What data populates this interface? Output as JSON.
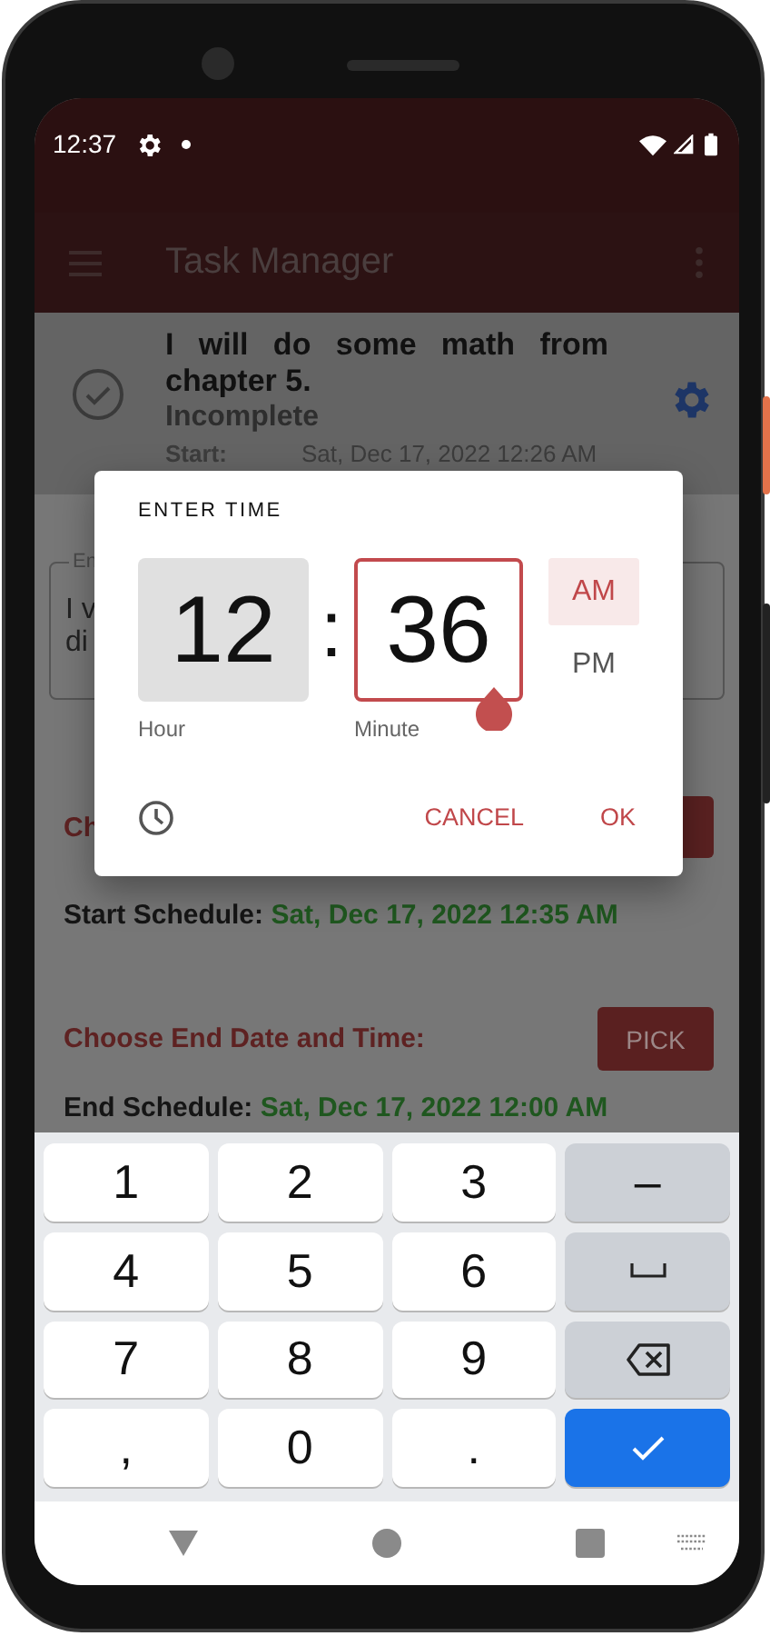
{
  "status_bar": {
    "time": "12:37"
  },
  "app_bar": {
    "title": "Task Manager"
  },
  "task": {
    "title": "I will do some math from chapter 5.",
    "status": "Incomplete",
    "start_label": "Start:",
    "start_value": "Sat, Dec 17, 2022 12:26 AM"
  },
  "form": {
    "field_label": "En",
    "field_lines": [
      "I v",
      "di"
    ],
    "start_heading": "Ch",
    "start_schedule_label": "Start Schedule:",
    "start_schedule_value": "Sat, Dec 17, 2022 12:35 AM",
    "end_heading": "Choose End Date and Time:",
    "end_button": "PICK",
    "end_schedule_label": "End Schedule:",
    "end_schedule_value": "Sat, Dec 17, 2022 12:00 AM"
  },
  "dialog": {
    "title": "ENTER TIME",
    "separator": ":",
    "fields": [
      {
        "value": "12",
        "label": "Hour",
        "focused": false
      },
      {
        "value": "36",
        "label": "Minute",
        "focused": true
      }
    ],
    "periods": [
      {
        "label": "AM",
        "selected": true
      },
      {
        "label": "PM",
        "selected": false
      }
    ],
    "buttons": [
      "CANCEL",
      "OK"
    ]
  },
  "keyboard": {
    "keys": [
      {
        "kind": "char",
        "label": "1"
      },
      {
        "kind": "char",
        "label": "2"
      },
      {
        "kind": "char",
        "label": "3"
      },
      {
        "kind": "function",
        "label": "–"
      },
      {
        "kind": "char",
        "label": "4"
      },
      {
        "kind": "char",
        "label": "5"
      },
      {
        "kind": "char",
        "label": "6"
      },
      {
        "kind": "space"
      },
      {
        "kind": "char",
        "label": "7"
      },
      {
        "kind": "char",
        "label": "8"
      },
      {
        "kind": "char",
        "label": "9"
      },
      {
        "kind": "backspace"
      },
      {
        "kind": "char",
        "label": ","
      },
      {
        "kind": "char",
        "label": "0"
      },
      {
        "kind": "char",
        "label": "."
      },
      {
        "kind": "enter"
      }
    ]
  }
}
